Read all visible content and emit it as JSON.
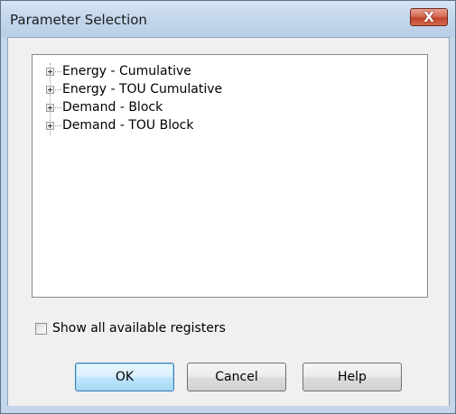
{
  "window": {
    "title": "Parameter Selection",
    "close_glyph": "X"
  },
  "tree": {
    "items": [
      {
        "label": "Energy - Cumulative",
        "expander_icon": "plus-box-icon"
      },
      {
        "label": "Energy - TOU Cumulative",
        "expander_icon": "plus-box-icon"
      },
      {
        "label": "Demand - Block",
        "expander_icon": "plus-box-icon"
      },
      {
        "label": "Demand - TOU Block",
        "expander_icon": "plus-box-icon"
      }
    ]
  },
  "options": {
    "show_all_registers_label": "Show all available registers",
    "show_all_registers_checked": false
  },
  "buttons": {
    "ok_label": "OK",
    "cancel_label": "Cancel",
    "help_label": "Help"
  },
  "colors": {
    "title_bar": "#c4d7ec",
    "close_button": "#c8523a",
    "dialog_face": "#f0f0f0",
    "default_button_border": "#3c7fb1"
  }
}
